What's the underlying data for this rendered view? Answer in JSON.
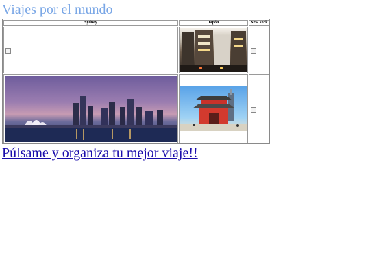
{
  "page": {
    "title": "Viajes por el mundo",
    "cta_link": "Púlsame y organiza tu mejor viaje!!"
  },
  "table": {
    "headers": [
      "Sydney",
      "Japón",
      "New York"
    ]
  },
  "colors": {
    "title": "#7aa7e6",
    "link": "#1a0dab"
  },
  "images": [
    {
      "name": "sydney-image-broken",
      "state": "broken"
    },
    {
      "name": "tokyo-street-image",
      "state": "loaded"
    },
    {
      "name": "newyork-image-broken",
      "state": "broken"
    },
    {
      "name": "sydney-skyline-image",
      "state": "loaded"
    },
    {
      "name": "japan-pagoda-image",
      "state": "loaded"
    },
    {
      "name": "newyork-image-broken-2",
      "state": "broken"
    }
  ]
}
